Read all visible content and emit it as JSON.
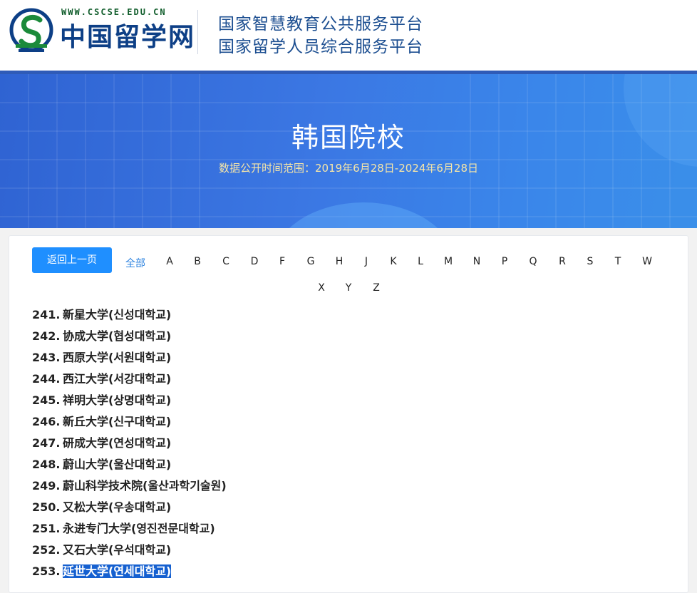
{
  "header": {
    "logo_url": "WWW.CSCSE.EDU.CN",
    "logo_name": "中国留学网",
    "platform_line1": "国家智慧教育公共服务平台",
    "platform_line2": "国家留学人员综合服务平台"
  },
  "banner": {
    "title": "韩国院校",
    "subtitle": "数据公开时间范围：2019年6月28日-2024年6月28日"
  },
  "nav": {
    "back_label": "返回上一页",
    "all_label": "全部",
    "letters_row1": [
      "A",
      "B",
      "C",
      "D",
      "F",
      "G",
      "H",
      "J",
      "K",
      "L",
      "M",
      "N",
      "P",
      "Q",
      "R",
      "S",
      "T",
      "W"
    ],
    "letters_row2": [
      "X",
      "Y",
      "Z"
    ]
  },
  "universities": [
    {
      "num": "241.",
      "name": "新星大学(신성대학교)"
    },
    {
      "num": "242.",
      "name": "协成大学(협성대학교)"
    },
    {
      "num": "243.",
      "name": "西原大学(서원대학교)"
    },
    {
      "num": "244.",
      "name": "西江大学(서강대학교)"
    },
    {
      "num": "245.",
      "name": "祥明大学(상명대학교)"
    },
    {
      "num": "246.",
      "name": "新丘大学(신구대학교)"
    },
    {
      "num": "247.",
      "name": "研成大学(연성대학교)"
    },
    {
      "num": "248.",
      "name": "蔚山大学(울산대학교)"
    },
    {
      "num": "249.",
      "name": "蔚山科学技术院(울산과학기술원)"
    },
    {
      "num": "250.",
      "name": "又松大学(우송대학교)"
    },
    {
      "num": "251.",
      "name": "永进专门大学(영진전문대학교)"
    },
    {
      "num": "252.",
      "name": "又石大学(우석대학교)"
    },
    {
      "num": "253.",
      "name": "延世大学(연세대학교)"
    }
  ],
  "colors": {
    "brand_blue": "#1f8fff",
    "banner_blue": "#3b77e3",
    "selection": "#1560d0",
    "logo_green": "#0f5c2a"
  }
}
